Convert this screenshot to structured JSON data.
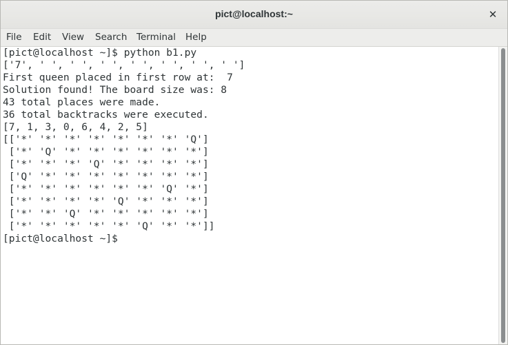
{
  "window": {
    "title": "pict@localhost:~",
    "close_glyph": "✕"
  },
  "menubar": {
    "items": [
      "File",
      "Edit",
      "View",
      "Search",
      "Terminal",
      "Help"
    ]
  },
  "terminal": {
    "lines": [
      "[pict@localhost ~]$ python b1.py",
      "['7', ' ', ' ', ' ', ' ', ' ', ' ', ' ']",
      "First queen placed in first row at:  7",
      "Solution found! The board size was: 8",
      "43 total places were made.",
      "36 total backtracks were executed.",
      "[7, 1, 3, 0, 6, 4, 2, 5]",
      "[['*' '*' '*' '*' '*' '*' '*' 'Q']",
      " ['*' 'Q' '*' '*' '*' '*' '*' '*']",
      " ['*' '*' '*' 'Q' '*' '*' '*' '*']",
      " ['Q' '*' '*' '*' '*' '*' '*' '*']",
      " ['*' '*' '*' '*' '*' '*' 'Q' '*']",
      " ['*' '*' '*' '*' 'Q' '*' '*' '*']",
      " ['*' '*' 'Q' '*' '*' '*' '*' '*']",
      " ['*' '*' '*' '*' '*' 'Q' '*' '*']]",
      "[pict@localhost ~]$"
    ]
  },
  "colors": {
    "text": "#2e3436",
    "background": "#ffffff",
    "titlebar": "#e8e8e7",
    "scroll_thumb": "#8b8e8f"
  }
}
